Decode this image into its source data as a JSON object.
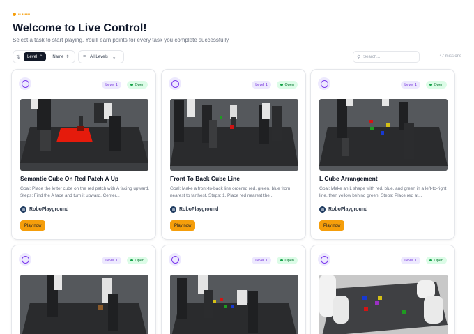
{
  "header": {
    "points_label": "•• ••••••",
    "title": "Welcome to Live Control!",
    "subtitle": "Select a task to start playing. You'll earn points for every task you complete successfully."
  },
  "toolbar": {
    "sort_options": [
      {
        "label": "Level",
        "active": true,
        "icon": "chevron-up-icon"
      },
      {
        "label": "Name",
        "active": false,
        "icon": "chevron-icon"
      }
    ],
    "filter_label": "All Levels",
    "search_placeholder": "Search...",
    "missions_count": "47 missions"
  },
  "colors": {
    "accent_purple": "#7c3aed",
    "open_green": "#16a34a",
    "play_amber": "#f59e0b",
    "dark": "#111827"
  },
  "cards": [
    {
      "level": "Level 1",
      "status": "Open",
      "title": "Semantic Cube On Red Patch A Up",
      "description": "Goal: Place the letter cube on the red patch with A facing upward. Steps: Find the A face and turn it upward. Center...",
      "author": "RoboPlayground",
      "play_label": "Play now",
      "scene": "red-patch"
    },
    {
      "level": "Level 1",
      "status": "Open",
      "title": "Front To Back Cube Line",
      "description": "Goal: Make a front-to-back line ordered red, green, blue from nearest to farthest. Steps: 1. Place red nearest the...",
      "author": "RoboPlayground",
      "play_label": "Play now",
      "scene": "dual-arm"
    },
    {
      "level": "Level 1",
      "status": "Open",
      "title": "L Cube Arrangement",
      "description": "Goal: Make an L shape with red, blue, and green in a left-to-right line, then yellow behind green. Steps: Place red at...",
      "author": "RoboPlayground",
      "play_label": "Play now",
      "scene": "cubes"
    },
    {
      "level": "Level 1",
      "status": "Open",
      "title": "",
      "description": "",
      "author": "",
      "play_label": "",
      "scene": "single-cube"
    },
    {
      "level": "Level 1",
      "status": "Open",
      "title": "",
      "description": "",
      "author": "",
      "play_label": "",
      "scene": "dual-arm-2"
    },
    {
      "level": "Level 1",
      "status": "Open",
      "title": "",
      "description": "",
      "author": "",
      "play_label": "",
      "scene": "white-arms"
    }
  ]
}
